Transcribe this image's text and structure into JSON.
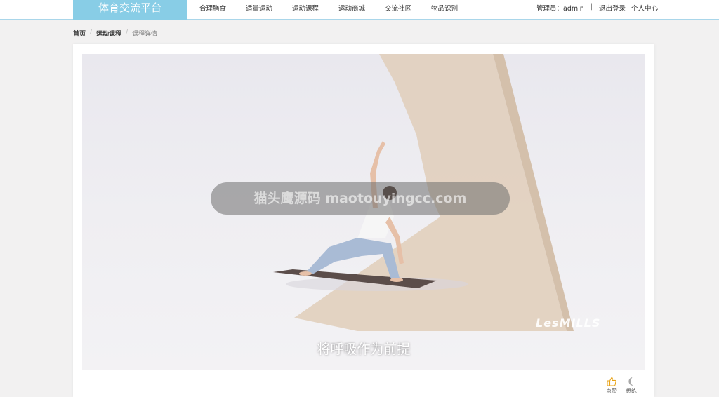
{
  "header": {
    "brand": "体育交流平台",
    "nav": [
      "合理膳食",
      "适量运动",
      "运动课程",
      "运动商城",
      "交流社区",
      "物品识别"
    ],
    "user_label": "管理员：admin",
    "separator": "|",
    "logout": "退出登录",
    "user_center": "个人中心"
  },
  "breadcrumb": {
    "home": "首页",
    "section": "运动课程",
    "separator": "/",
    "current": "课程详情"
  },
  "video": {
    "overlay_text": "猫头鹰源码 maotouyingcc.com",
    "subtitle": "将呼吸作为前提",
    "logo": "LesMILLS"
  },
  "actions": {
    "like_label": "点赞",
    "favorite_label": "想练"
  },
  "colors": {
    "brand_bg": "#88cde6",
    "header_border": "#a9d6ea",
    "page_bg": "#f2f1f1",
    "like_icon": "#e8a317"
  }
}
